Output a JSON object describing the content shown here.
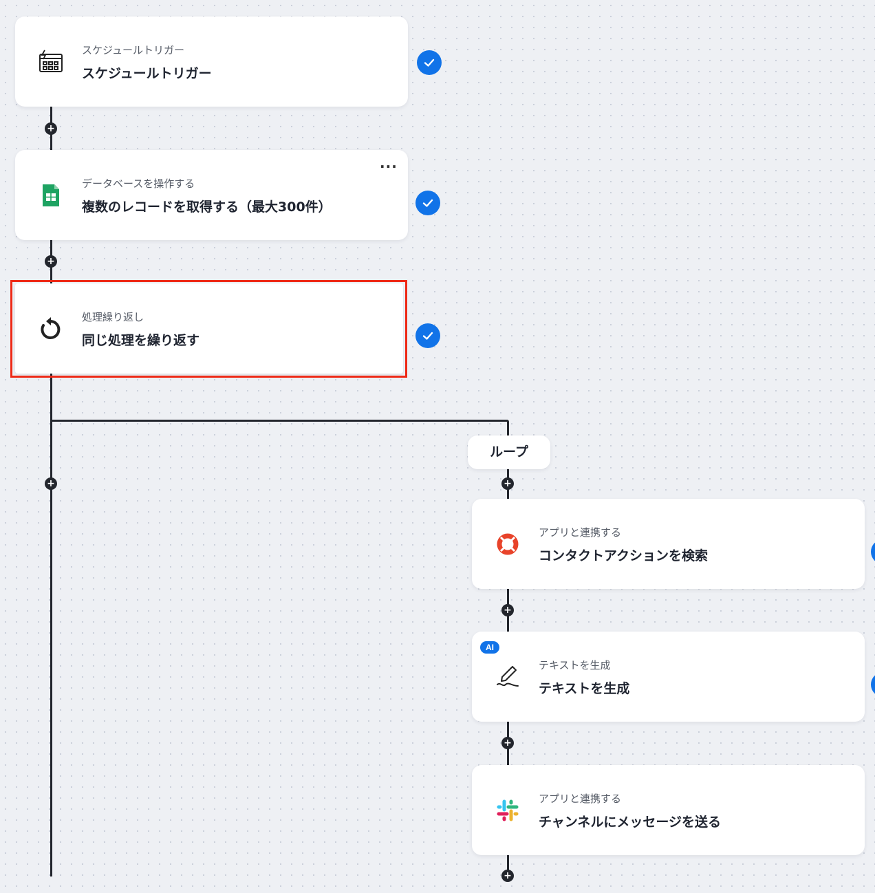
{
  "steps": [
    {
      "sub": "スケジュールトリガー",
      "title": "スケジュールトリガー",
      "icon": "calendar-bolt-icon",
      "status": "completed"
    },
    {
      "sub": "データベースを操作する",
      "title": "複数のレコードを取得する（最大300件）",
      "icon": "google-sheets-icon",
      "status": "completed",
      "menu": "···"
    },
    {
      "sub": "処理繰り返し",
      "title": "同じ処理を繰り返す",
      "icon": "loop-icon",
      "status": "completed",
      "highlighted": true
    }
  ],
  "loop": {
    "label": "ループ",
    "steps": [
      {
        "sub": "アプリと連携する",
        "title": "コンタクトアクションを検索",
        "icon": "lifebuoy-icon"
      },
      {
        "sub": "テキストを生成",
        "title": "テキストを生成",
        "icon": "pen-icon",
        "badge": "AI"
      },
      {
        "sub": "アプリと連携する",
        "title": "チャンネルにメッセージを送る",
        "icon": "slack-icon"
      }
    ]
  },
  "colors": {
    "accent": "#1173e8",
    "highlight": "#ee2a17",
    "line": "#23262d"
  }
}
